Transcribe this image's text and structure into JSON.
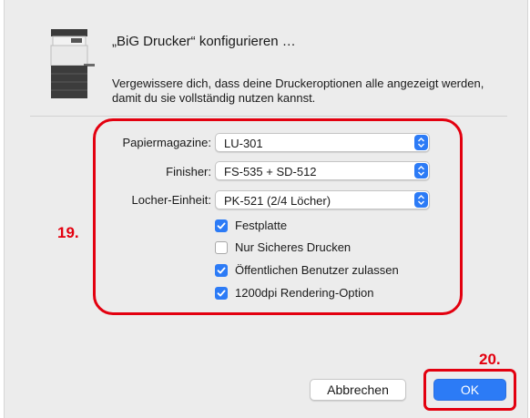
{
  "dialog": {
    "title": "„BiG Drucker“ konfigurieren …",
    "description": "Vergewissere dich, dass deine Druckeroptionen alle angezeigt werden, damit du sie vollständig nutzen kannst."
  },
  "options": {
    "papiermagazine": {
      "label": "Papiermagazine:",
      "value": "LU-301"
    },
    "finisher": {
      "label": "Finisher:",
      "value": "FS-535 + SD-512"
    },
    "locher": {
      "label": "Locher-Einheit:",
      "value": "PK-521 (2/4 Löcher)"
    }
  },
  "checkboxes": [
    {
      "label": "Festplatte",
      "checked": true
    },
    {
      "label": "Nur Sicheres Drucken",
      "checked": false
    },
    {
      "label": "Öffentlichen Benutzer zulassen",
      "checked": true
    },
    {
      "label": "1200dpi Rendering-Option",
      "checked": true
    }
  ],
  "buttons": {
    "cancel": "Abbrechen",
    "ok": "OK"
  },
  "callouts": {
    "options_step": "19.",
    "ok_step": "20."
  },
  "colors": {
    "accent": "#2c7bf6",
    "callout": "#e3000f",
    "dialog_bg": "#ececec"
  },
  "icons": {
    "printer": "printer-icon",
    "checkmark": "checkmark-icon",
    "stepper": "up-down-chevron-icon"
  }
}
